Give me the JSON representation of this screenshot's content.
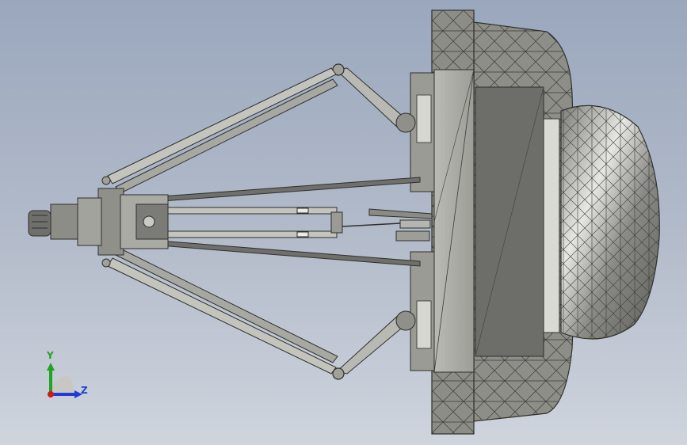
{
  "viewport": {
    "background_top": "#9aa7bd",
    "background_bottom": "#cfd4dd",
    "model_color": "#8f908a",
    "model_shade_dark": "#5c5d58",
    "model_shade_light": "#c9cac4"
  },
  "triad": {
    "y_label": "Y",
    "z_label": "Z",
    "y_color": "#1fa51f",
    "z_color": "#1e3fd6",
    "x_color": "#d01818"
  }
}
